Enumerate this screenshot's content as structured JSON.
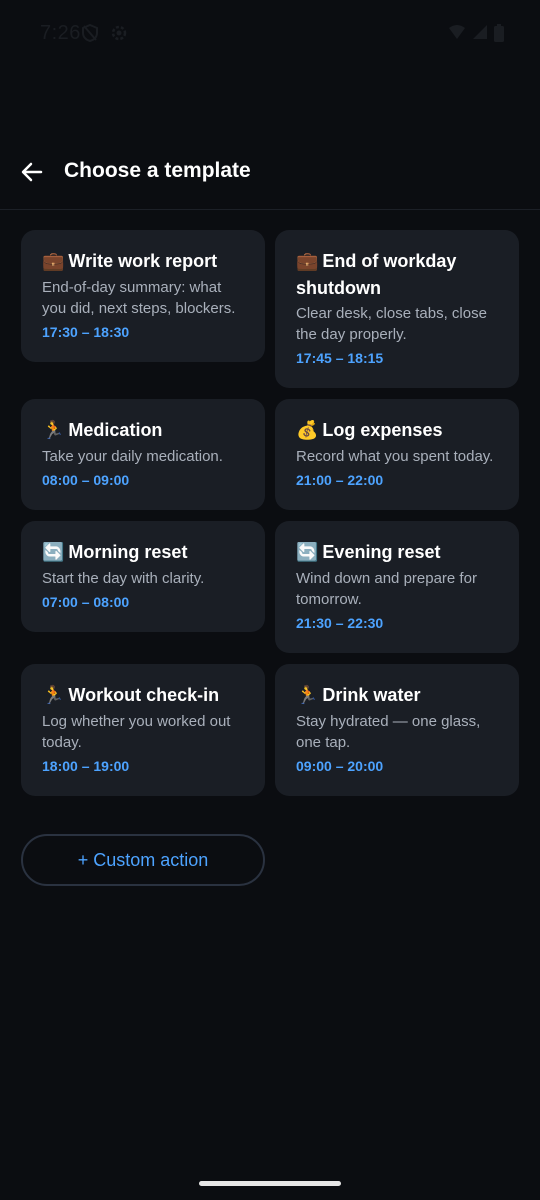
{
  "status_bar": {
    "time": "7:26",
    "icons": [
      "shield-icon",
      "settings-gear-icon",
      "wifi-icon",
      "signal-icon",
      "battery-icon"
    ]
  },
  "app_bar": {
    "back_icon": "arrow-left-icon",
    "title": "Choose a template"
  },
  "templates": [
    {
      "emoji": "💼",
      "title": "Write work report",
      "description": "End-of-day summary: what you did, next steps, blockers.",
      "time": "17:30 – 18:30"
    },
    {
      "emoji": "💼",
      "title": "End of workday shutdown",
      "description": "Clear desk, close tabs, close the day properly.",
      "time": "17:45 – 18:15"
    },
    {
      "emoji": "🏃",
      "title": "Medication",
      "description": "Take your daily medication.",
      "time": "08:00 – 09:00"
    },
    {
      "emoji": "💰",
      "title": "Log expenses",
      "description": "Record what you spent today.",
      "time": "21:00 – 22:00"
    },
    {
      "emoji": "🔄",
      "title": "Morning reset",
      "description": "Start the day with clarity.",
      "time": "07:00 – 08:00"
    },
    {
      "emoji": "🔄",
      "title": "Evening reset",
      "description": "Wind down and prepare for tomorrow.",
      "time": "21:30 – 22:30"
    },
    {
      "emoji": "🏃",
      "title": "Workout check-in",
      "description": "Log whether you worked out today.",
      "time": "18:00 – 19:00"
    },
    {
      "emoji": "🏃",
      "title": "Drink water",
      "description": "Stay hydrated — one glass, one tap.",
      "time": "09:00 – 20:00"
    }
  ],
  "custom_action": {
    "label": "+ Custom action"
  },
  "colors": {
    "background": "#0b0d11",
    "card": "#1a1e25",
    "accent": "#4da3ff",
    "text_secondary": "#a9b0bb"
  }
}
